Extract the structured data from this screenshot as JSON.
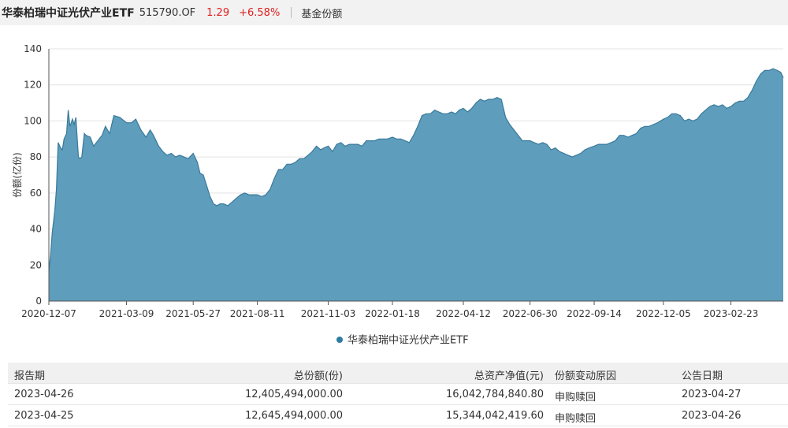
{
  "header": {
    "fund_name": "华泰柏瑞中证光伏产业ETF",
    "fund_code": "515790.OF",
    "price": "1.29",
    "change": "+6.58%",
    "title": "基金份额"
  },
  "colors": {
    "area_fill": "#5e9dbb",
    "area_line": "#3a7a9b",
    "legend_marker": "#2e7ca3",
    "price_red": "#e02020"
  },
  "chart_data": {
    "type": "area",
    "ylabel": "份额(亿份)",
    "ylim": [
      0,
      140
    ],
    "yticks": [
      "0",
      "20",
      "40",
      "60",
      "80",
      "100",
      "120",
      "140"
    ],
    "xticks": [
      "2020-12-07",
      "2021-03-09",
      "2021-05-27",
      "2021-08-11",
      "2021-11-03",
      "2022-01-18",
      "2022-04-12",
      "2022-06-30",
      "2022-09-14",
      "2022-12-05",
      "2023-02-23"
    ],
    "grid": "horizontal",
    "legend_position": "bottom",
    "series": [
      {
        "name": "华泰柏瑞中证光伏产业ETF",
        "points": [
          [
            "2020-12-07",
            17
          ],
          [
            "2020-12-09",
            25
          ],
          [
            "2020-12-11",
            38
          ],
          [
            "2020-12-14",
            50
          ],
          [
            "2020-12-16",
            62
          ],
          [
            "2020-12-18",
            88
          ],
          [
            "2020-12-21",
            85
          ],
          [
            "2020-12-23",
            84
          ],
          [
            "2020-12-25",
            90
          ],
          [
            "2020-12-28",
            93
          ],
          [
            "2020-12-30",
            106
          ],
          [
            "2021-01-01",
            97
          ],
          [
            "2021-01-04",
            101
          ],
          [
            "2021-01-06",
            98
          ],
          [
            "2021-01-08",
            102
          ],
          [
            "2021-01-11",
            80
          ],
          [
            "2021-01-13",
            79
          ],
          [
            "2021-01-15",
            80
          ],
          [
            "2021-01-18",
            93
          ],
          [
            "2021-01-20",
            92
          ],
          [
            "2021-01-25",
            91
          ],
          [
            "2021-01-29",
            86
          ],
          [
            "2021-02-03",
            89
          ],
          [
            "2021-02-08",
            92
          ],
          [
            "2021-02-12",
            97
          ],
          [
            "2021-02-17",
            93
          ],
          [
            "2021-02-22",
            103
          ],
          [
            "2021-03-01",
            102
          ],
          [
            "2021-03-09",
            99
          ],
          [
            "2021-03-15",
            99
          ],
          [
            "2021-03-20",
            101
          ],
          [
            "2021-03-26",
            95
          ],
          [
            "2021-04-01",
            91
          ],
          [
            "2021-04-06",
            95
          ],
          [
            "2021-04-10",
            92
          ],
          [
            "2021-04-16",
            86
          ],
          [
            "2021-04-21",
            83
          ],
          [
            "2021-04-26",
            81
          ],
          [
            "2021-05-01",
            82
          ],
          [
            "2021-05-06",
            80
          ],
          [
            "2021-05-11",
            81
          ],
          [
            "2021-05-16",
            80
          ],
          [
            "2021-05-21",
            79
          ],
          [
            "2021-05-27",
            82
          ],
          [
            "2021-06-01",
            77
          ],
          [
            "2021-06-04",
            71
          ],
          [
            "2021-06-08",
            70
          ],
          [
            "2021-06-12",
            64
          ],
          [
            "2021-06-16",
            58
          ],
          [
            "2021-06-20",
            54
          ],
          [
            "2021-06-24",
            53
          ],
          [
            "2021-06-28",
            54
          ],
          [
            "2021-07-02",
            54
          ],
          [
            "2021-07-07",
            53
          ],
          [
            "2021-07-12",
            55
          ],
          [
            "2021-07-17",
            57
          ],
          [
            "2021-07-22",
            59
          ],
          [
            "2021-07-27",
            60
          ],
          [
            "2021-08-01",
            59
          ],
          [
            "2021-08-06",
            59
          ],
          [
            "2021-08-11",
            59
          ],
          [
            "2021-08-16",
            58
          ],
          [
            "2021-08-21",
            59
          ],
          [
            "2021-08-26",
            62
          ],
          [
            "2021-08-31",
            68
          ],
          [
            "2021-09-05",
            73
          ],
          [
            "2021-09-10",
            73
          ],
          [
            "2021-09-15",
            76
          ],
          [
            "2021-09-20",
            76
          ],
          [
            "2021-09-25",
            77
          ],
          [
            "2021-09-30",
            79
          ],
          [
            "2021-10-05",
            79
          ],
          [
            "2021-10-10",
            81
          ],
          [
            "2021-10-15",
            83
          ],
          [
            "2021-10-20",
            86
          ],
          [
            "2021-10-25",
            84
          ],
          [
            "2021-10-29",
            85
          ],
          [
            "2021-11-03",
            86
          ],
          [
            "2021-11-08",
            83
          ],
          [
            "2021-11-13",
            87
          ],
          [
            "2021-11-18",
            88
          ],
          [
            "2021-11-23",
            86
          ],
          [
            "2021-11-28",
            87
          ],
          [
            "2021-12-03",
            87
          ],
          [
            "2021-12-08",
            87
          ],
          [
            "2021-12-13",
            86
          ],
          [
            "2021-12-18",
            89
          ],
          [
            "2021-12-23",
            89
          ],
          [
            "2021-12-28",
            89
          ],
          [
            "2022-01-02",
            90
          ],
          [
            "2022-01-07",
            90
          ],
          [
            "2022-01-12",
            90
          ],
          [
            "2022-01-18",
            91
          ],
          [
            "2022-01-23",
            90
          ],
          [
            "2022-01-28",
            90
          ],
          [
            "2022-02-02",
            89
          ],
          [
            "2022-02-07",
            88
          ],
          [
            "2022-02-12",
            92
          ],
          [
            "2022-02-17",
            97
          ],
          [
            "2022-02-22",
            103
          ],
          [
            "2022-02-27",
            104
          ],
          [
            "2022-03-04",
            104
          ],
          [
            "2022-03-09",
            106
          ],
          [
            "2022-03-14",
            105
          ],
          [
            "2022-03-19",
            104
          ],
          [
            "2022-03-24",
            104
          ],
          [
            "2022-03-29",
            105
          ],
          [
            "2022-04-03",
            104
          ],
          [
            "2022-04-07",
            106
          ],
          [
            "2022-04-12",
            107
          ],
          [
            "2022-04-17",
            105
          ],
          [
            "2022-04-22",
            107
          ],
          [
            "2022-04-27",
            110
          ],
          [
            "2022-05-02",
            112
          ],
          [
            "2022-05-07",
            111
          ],
          [
            "2022-05-12",
            112
          ],
          [
            "2022-05-17",
            112
          ],
          [
            "2022-05-22",
            113
          ],
          [
            "2022-05-27",
            112
          ],
          [
            "2022-06-01",
            102
          ],
          [
            "2022-06-06",
            98
          ],
          [
            "2022-06-11",
            95
          ],
          [
            "2022-06-16",
            92
          ],
          [
            "2022-06-21",
            89
          ],
          [
            "2022-06-26",
            89
          ],
          [
            "2022-06-30",
            89
          ],
          [
            "2022-07-05",
            88
          ],
          [
            "2022-07-10",
            87
          ],
          [
            "2022-07-15",
            88
          ],
          [
            "2022-07-20",
            87
          ],
          [
            "2022-07-25",
            84
          ],
          [
            "2022-07-30",
            85
          ],
          [
            "2022-08-04",
            83
          ],
          [
            "2022-08-09",
            82
          ],
          [
            "2022-08-14",
            81
          ],
          [
            "2022-08-19",
            80
          ],
          [
            "2022-08-24",
            81
          ],
          [
            "2022-08-29",
            82
          ],
          [
            "2022-09-03",
            84
          ],
          [
            "2022-09-08",
            85
          ],
          [
            "2022-09-14",
            86
          ],
          [
            "2022-09-19",
            87
          ],
          [
            "2022-09-24",
            87
          ],
          [
            "2022-09-29",
            87
          ],
          [
            "2022-10-04",
            88
          ],
          [
            "2022-10-09",
            89
          ],
          [
            "2022-10-14",
            92
          ],
          [
            "2022-10-19",
            92
          ],
          [
            "2022-10-24",
            91
          ],
          [
            "2022-10-29",
            92
          ],
          [
            "2022-11-03",
            93
          ],
          [
            "2022-11-08",
            96
          ],
          [
            "2022-11-13",
            97
          ],
          [
            "2022-11-18",
            97
          ],
          [
            "2022-11-23",
            98
          ],
          [
            "2022-11-28",
            99
          ],
          [
            "2022-12-05",
            101
          ],
          [
            "2022-12-10",
            102
          ],
          [
            "2022-12-15",
            104
          ],
          [
            "2022-12-20",
            104
          ],
          [
            "2022-12-25",
            103
          ],
          [
            "2022-12-30",
            100
          ],
          [
            "2023-01-04",
            101
          ],
          [
            "2023-01-09",
            100
          ],
          [
            "2023-01-14",
            101
          ],
          [
            "2023-01-19",
            104
          ],
          [
            "2023-01-24",
            106
          ],
          [
            "2023-01-29",
            108
          ],
          [
            "2023-02-03",
            109
          ],
          [
            "2023-02-08",
            108
          ],
          [
            "2023-02-13",
            109
          ],
          [
            "2023-02-18",
            107
          ],
          [
            "2023-02-23",
            108
          ],
          [
            "2023-02-28",
            110
          ],
          [
            "2023-03-05",
            111
          ],
          [
            "2023-03-10",
            111
          ],
          [
            "2023-03-15",
            113
          ],
          [
            "2023-03-20",
            117
          ],
          [
            "2023-03-25",
            122
          ],
          [
            "2023-03-30",
            126
          ],
          [
            "2023-04-04",
            128
          ],
          [
            "2023-04-09",
            128
          ],
          [
            "2023-04-14",
            129
          ],
          [
            "2023-04-19",
            128
          ],
          [
            "2023-04-23",
            127
          ],
          [
            "2023-04-26",
            124
          ]
        ]
      }
    ]
  },
  "table": {
    "headers": [
      "报告期",
      "总份额(份)",
      "总资产净值(元)",
      "份额变动原因",
      "公告日期"
    ],
    "rows": [
      [
        "2023-04-26",
        "12,405,494,000.00",
        "16,042,784,840.80",
        "申购赎回",
        "2023-04-27"
      ],
      [
        "2023-04-25",
        "12,645,494,000.00",
        "15,344,042,419.60",
        "申购赎回",
        "2023-04-26"
      ]
    ]
  }
}
